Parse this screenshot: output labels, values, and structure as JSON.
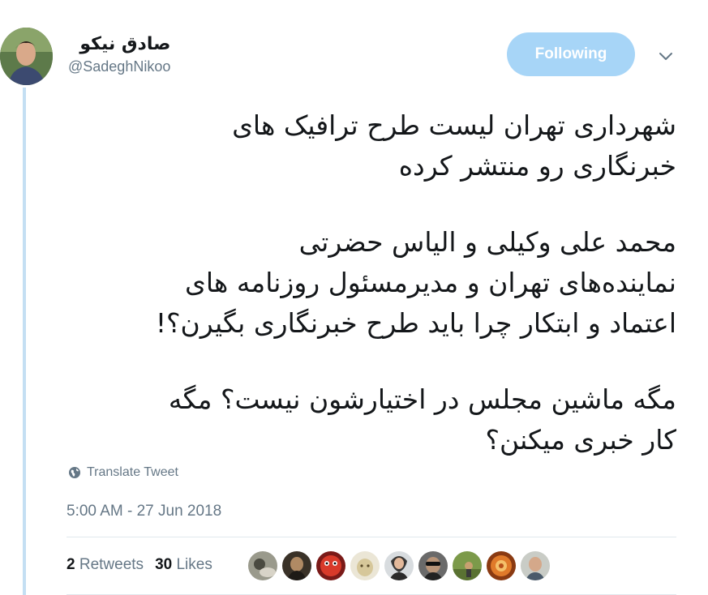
{
  "user": {
    "display_name": "صادق نیکو",
    "handle": "@SadeghNikoo"
  },
  "follow_button": {
    "label": "Following",
    "color": "#a7d5f7"
  },
  "menu": {
    "icon": "chevron-down-icon"
  },
  "tweet": {
    "paragraphs": [
      [
        "شهرداری تهران لیست طرح ترافیک های",
        "خبرنگاری رو منتشر کرده"
      ],
      [
        "محمد علی وکیلی و الیاس حضرتی",
        "نماینده‌های تهران و مدیرمسئول روزنامه های",
        "اعتماد و ابتکار چرا باید طرح خبرنگاری بگیرن؟!"
      ],
      [
        "مگه ماشین مجلس در اختیارشون نیست؟ مگه",
        "کار خبری میکنن؟"
      ]
    ]
  },
  "translate": {
    "label": "Translate Tweet",
    "icon": "globe-icon"
  },
  "timestamp": "5:00 AM - 27 Jun 2018",
  "stats": {
    "retweets_count": "2",
    "retweets_label": "Retweets",
    "likes_count": "30",
    "likes_label": "Likes"
  },
  "likers_count": 9,
  "colors": {
    "thread_line": "#c4dff3",
    "secondary_text": "#657786",
    "divider": "#e1e8ed"
  }
}
